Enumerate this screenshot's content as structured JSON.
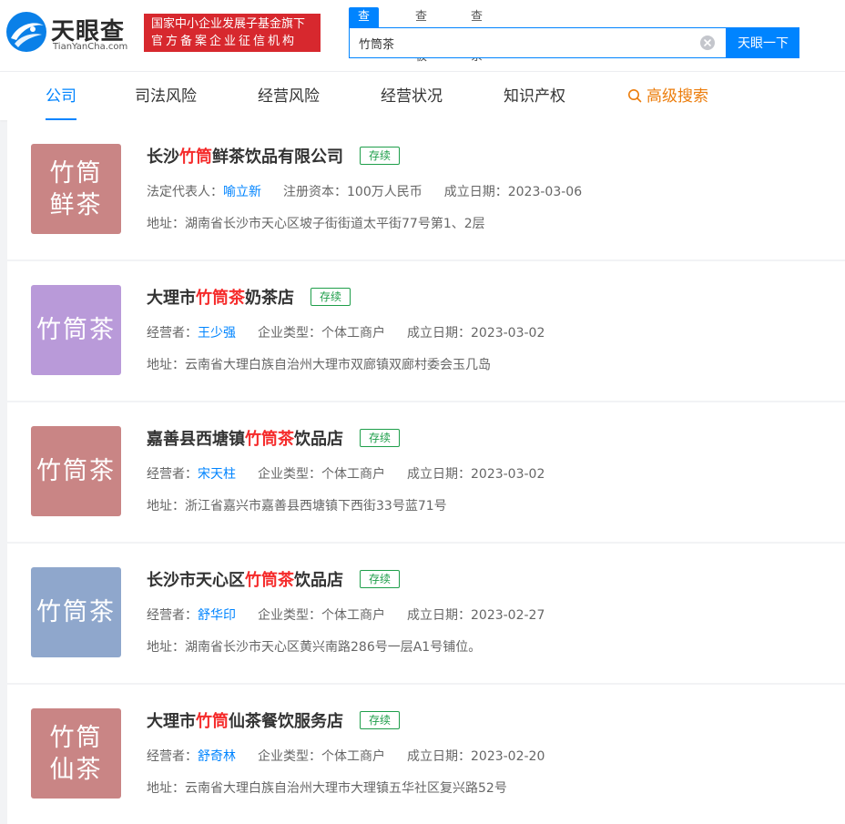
{
  "header": {
    "logo_cn": "天眼查",
    "logo_en": "TianYanCha.com",
    "badge_line1": "国家中小企业发展子基金旗下",
    "badge_line2": "官方备案企业征信机构",
    "search_tabs": [
      "查公司",
      "查老板",
      "查关系"
    ],
    "search_value": "竹筒茶",
    "search_button": "天眼一下"
  },
  "nav": {
    "items": [
      "公司",
      "司法风险",
      "经营风险",
      "经营状况",
      "知识产权"
    ],
    "advanced": "高级搜索"
  },
  "colors": {
    "accent": "#0084ff",
    "highlight": "#f52b2b",
    "status_green": "#1e9e4a",
    "logo_red": "#c98585",
    "logo_purple": "#b99ad9",
    "logo_blue": "#8fa7cc"
  },
  "companies": [
    {
      "logo_lines": [
        "竹筒",
        "鲜茶"
      ],
      "logo_color": "#c98585",
      "name_pre": "长沙",
      "name_hl": "竹筒",
      "name_post": "鲜茶饮品有限公司",
      "status": "存续",
      "f1_label": "法定代表人：",
      "f1_value": "喻立新",
      "f2": "注册资本：100万人民币",
      "f3": "成立日期：2023-03-06",
      "address": "地址：湖南省长沙市天心区坡子街街道太平街77号第1、2层"
    },
    {
      "logo_lines": [
        "竹筒茶"
      ],
      "logo_color": "#b99ad9",
      "name_pre": "大理市",
      "name_hl": "竹筒茶",
      "name_post": "奶茶店",
      "status": "存续",
      "f1_label": "经营者：",
      "f1_value": "王少强",
      "f2": "企业类型：个体工商户",
      "f3": "成立日期：2023-03-02",
      "address": "地址：云南省大理白族自治州大理市双廊镇双廊村委会玉几岛"
    },
    {
      "logo_lines": [
        "竹筒茶"
      ],
      "logo_color": "#c98585",
      "name_pre": "嘉善县西塘镇",
      "name_hl": "竹筒茶",
      "name_post": "饮品店",
      "status": "存续",
      "f1_label": "经营者：",
      "f1_value": "宋天柱",
      "f2": "企业类型：个体工商户",
      "f3": "成立日期：2023-03-02",
      "address": "地址：浙江省嘉兴市嘉善县西塘镇下西街33号蓝71号"
    },
    {
      "logo_lines": [
        "竹筒茶"
      ],
      "logo_color": "#8fa7cc",
      "name_pre": "长沙市天心区",
      "name_hl": "竹筒茶",
      "name_post": "饮品店",
      "status": "存续",
      "f1_label": "经营者：",
      "f1_value": "舒华印",
      "f2": "企业类型：个体工商户",
      "f3": "成立日期：2023-02-27",
      "address": "地址：湖南省长沙市天心区黄兴南路286号一层A1号铺位。"
    },
    {
      "logo_lines": [
        "竹筒",
        "仙茶"
      ],
      "logo_color": "#c98585",
      "name_pre": "大理市",
      "name_hl": "竹筒",
      "name_post": "仙茶餐饮服务店",
      "status": "存续",
      "f1_label": "经营者：",
      "f1_value": "舒奇林",
      "f2": "企业类型：个体工商户",
      "f3": "成立日期：2023-02-20",
      "address": "地址：云南省大理白族自治州大理市大理镇五华社区复兴路52号"
    }
  ]
}
